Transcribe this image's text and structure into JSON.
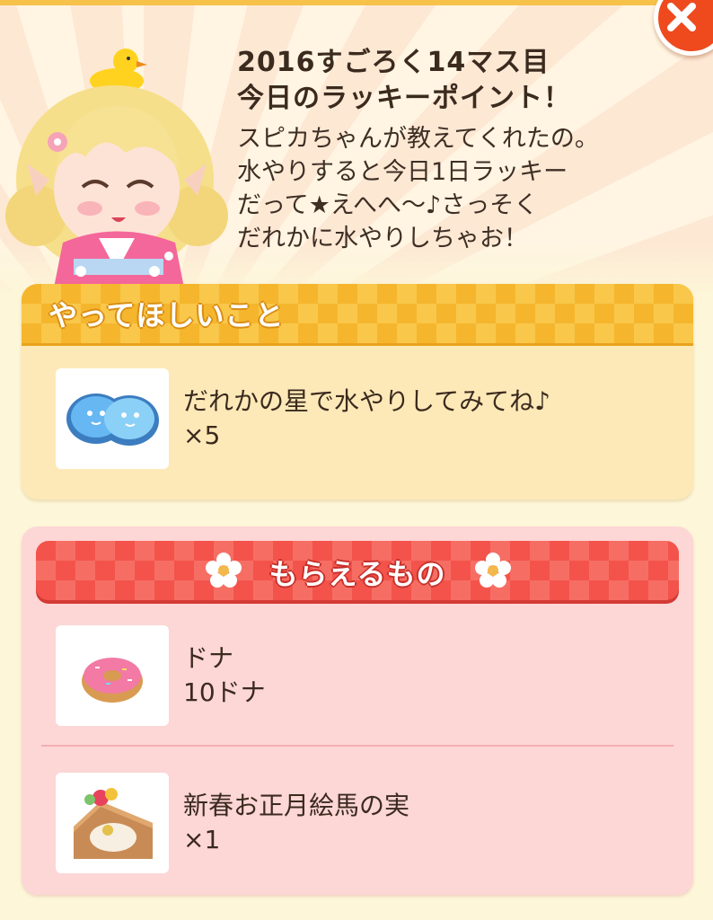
{
  "intro": {
    "title_line1": "2016すごろく14マス目",
    "title_line2": "今日のラッキーポイント！",
    "body": "スピカちゃんが教えてくれたの。\n水やりすると今日1日ラッキー\nだって★えへへ～♪さっそく\nだれかに水やりしちゃお！"
  },
  "task": {
    "header": "やってほしいこと",
    "items": [
      {
        "icon": "water-drops-icon",
        "label": "だれかの星で水やりしてみてね♪",
        "count": "×5"
      }
    ]
  },
  "reward": {
    "header": "もらえるもの",
    "items": [
      {
        "icon": "donut-icon",
        "label": "ドナ",
        "count": "10ドナ"
      },
      {
        "icon": "ema-fruit-icon",
        "label": "新春お正月絵馬の実",
        "count": "×1"
      }
    ]
  },
  "close": {
    "icon": "close-icon"
  },
  "colors": {
    "task_header": "#f5b62d",
    "task_panel": "#fde9b8",
    "reward_header": "#f3534b",
    "reward_panel": "#fdd6d6",
    "close_button": "#ee4a1e"
  }
}
